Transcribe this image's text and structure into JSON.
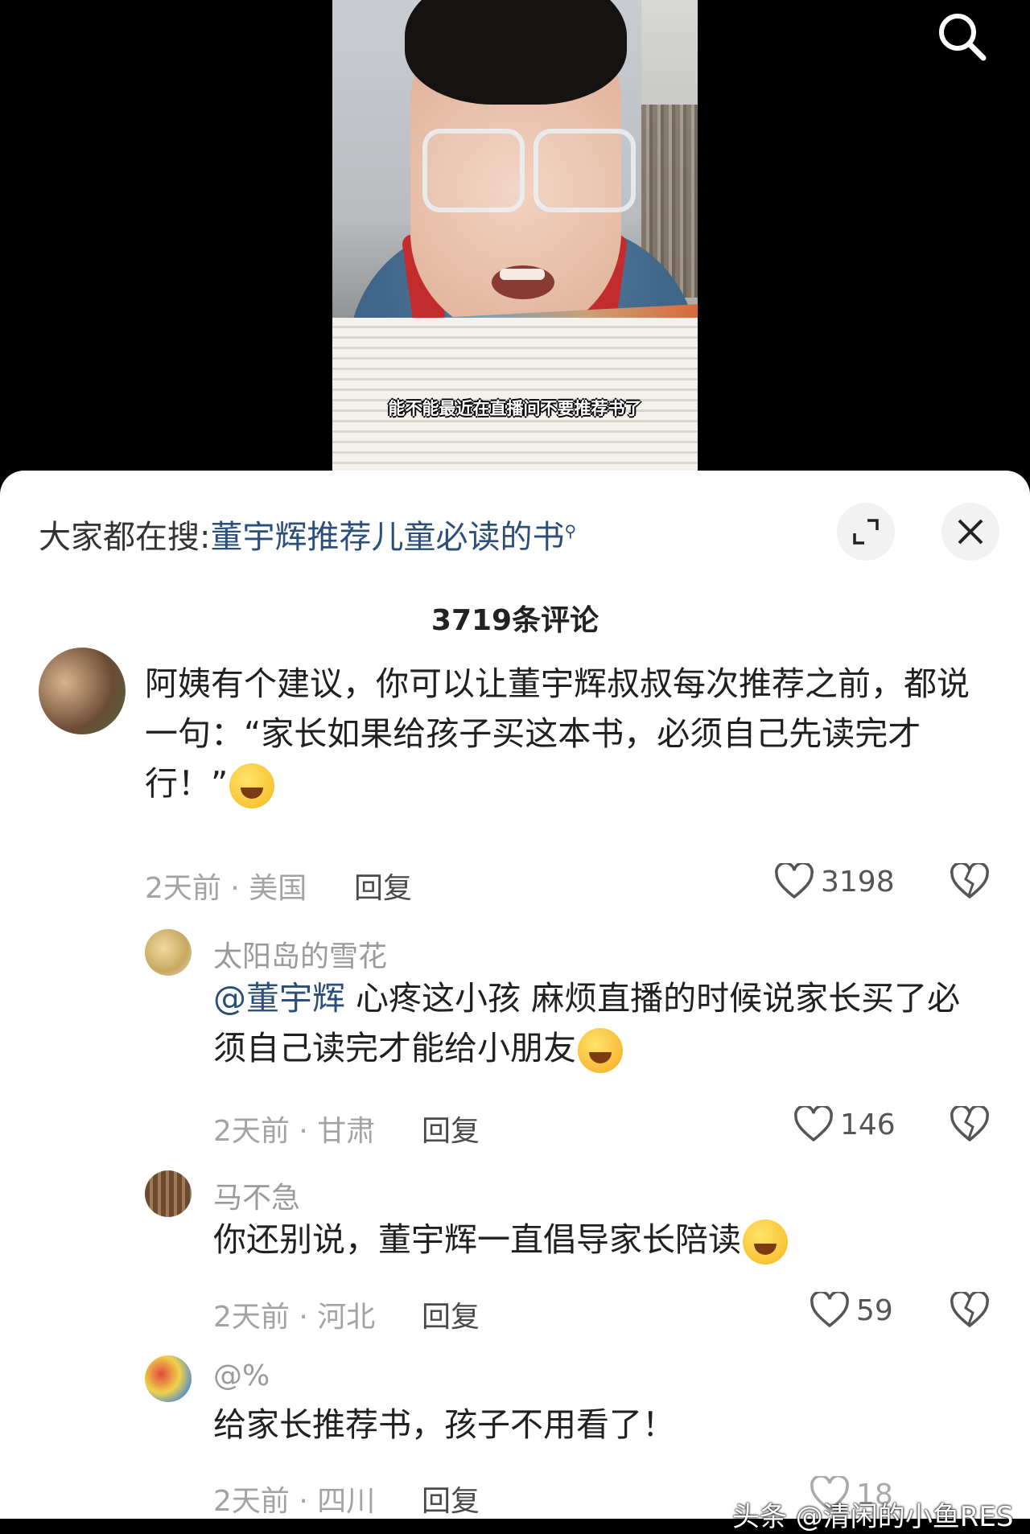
{
  "video": {
    "subtitle": "能不能最近在直播间不要推荐书了"
  },
  "header": {
    "trend_prefix": "大家都在搜:",
    "trend_link": "董宇辉推荐儿童必读的书",
    "comment_count": "3719条评论"
  },
  "icons": {
    "search": "search-icon",
    "expand": "expand-icon",
    "close": "close-icon",
    "like": "heart-icon",
    "dislike": "broken-heart-icon"
  },
  "comments": [
    {
      "username": "",
      "text": "阿姨有个建议，你可以让董宇辉叔叔每次推荐之前，都说一句：“家长如果给孩子买这本书，必须自己先读完才行！”",
      "meta": "2天前 · 美国",
      "reply": "回复",
      "likes": "3198"
    },
    {
      "username": "太阳岛的雪花",
      "mention": "@董宇辉",
      "text": " 心疼这小孩  麻烦直播的时候说家长买了必须自己读完才能给小朋友",
      "meta": "2天前 · 甘肃",
      "reply": "回复",
      "likes": "146"
    },
    {
      "username": "马不急",
      "text": "你还别说，董宇辉一直倡导家长陪读",
      "meta": "2天前 · 河北",
      "reply": "回复",
      "likes": "59"
    },
    {
      "username": "@%",
      "text": "给家长推荐书，孩子不用看了！",
      "meta": "2天前 · 四川",
      "reply": "回复",
      "likes": "18"
    }
  ],
  "watermark": "头条 @清闲的小鱼RES",
  "colors": {
    "link": "#2b4f7a",
    "muted": "#a3a3a3",
    "text": "#202020"
  }
}
